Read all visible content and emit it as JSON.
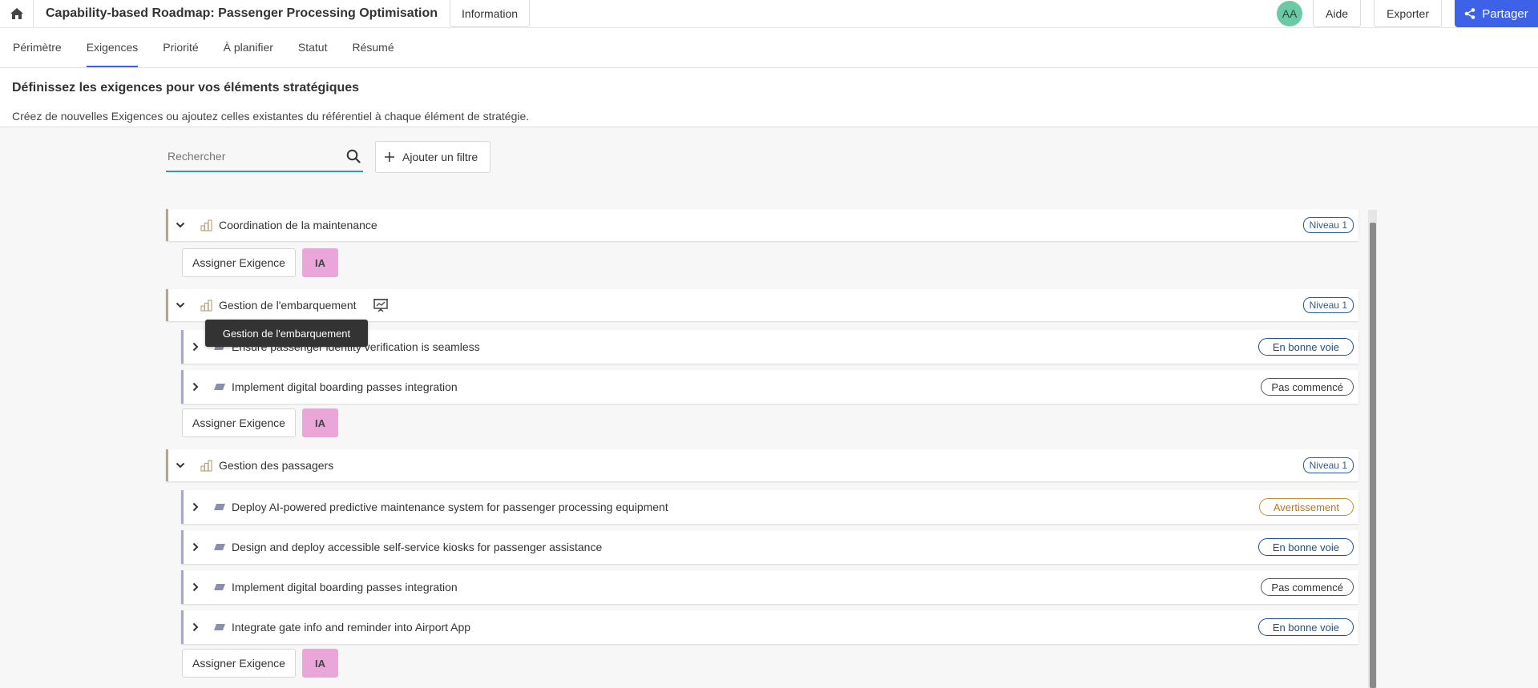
{
  "topbar": {
    "title": "Capability-based Roadmap: Passenger Processing Optimisation",
    "info_label": "Information",
    "avatar_initials": "AA",
    "help_label": "Aide",
    "export_label": "Exporter",
    "share_label": "Partager"
  },
  "tabs": [
    {
      "label": "Périmètre"
    },
    {
      "label": "Exigences"
    },
    {
      "label": "Priorité"
    },
    {
      "label": "À planifier"
    },
    {
      "label": "Statut"
    },
    {
      "label": "Résumé"
    }
  ],
  "active_tab": "Exigences",
  "section": {
    "title": "Définissez les exigences pour vos éléments stratégiques",
    "description": "Créez de nouvelles Exigences ou ajoutez celles existantes du référentiel à chaque élément de stratégie."
  },
  "search": {
    "placeholder": "Rechercher"
  },
  "filter_label": "Ajouter un filtre",
  "assign_label": "Assigner Exigence",
  "ia_label": "IA",
  "capabilities": [
    {
      "label": "Coordination de la maintenance",
      "level": "Niveau 1",
      "requirements": []
    },
    {
      "label": "Gestion de l'embarquement",
      "level": "Niveau 1",
      "requirements": [
        {
          "label": "Ensure passenger identity verification is seamless",
          "status": "En bonne voie"
        },
        {
          "label": "Implement digital boarding passes integration",
          "status": "Pas commencé"
        }
      ]
    },
    {
      "label": "Gestion des passagers",
      "level": "Niveau 1",
      "requirements": [
        {
          "label": "Deploy AI-powered predictive maintenance system for passenger processing equipment",
          "status": "Avertissement"
        },
        {
          "label": "Design and deploy accessible self-service kiosks for passenger assistance",
          "status": "En bonne voie"
        },
        {
          "label": "Implement digital boarding passes integration",
          "status": "Pas commencé"
        },
        {
          "label": "Integrate gate info and reminder into Airport App",
          "status": "En bonne voie"
        }
      ]
    }
  ],
  "tooltip": "Gestion de l'embarquement",
  "colors": {
    "accent": "#3d62e8",
    "avatar": "#6cc9a6",
    "ia_button": "#eaa5d9",
    "status_on_track": "#1d4f8c",
    "status_warning": "#c8902a"
  }
}
